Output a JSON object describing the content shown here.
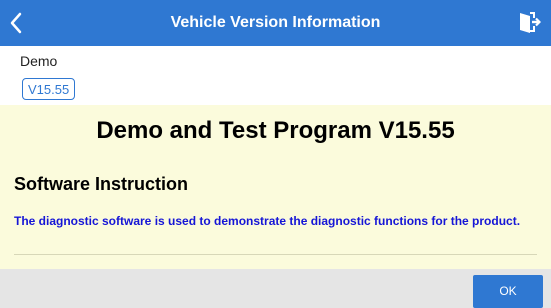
{
  "header": {
    "title": "Vehicle Version Information",
    "back_icon": "chevron-left-icon",
    "exit_icon": "exit-icon",
    "color": "#2f78d2"
  },
  "vehicle": {
    "name": "Demo",
    "version": "V15.55"
  },
  "content": {
    "program_title": "Demo and Test Program V15.55",
    "section_title": "Software Instruction",
    "instruction_text": "The diagnostic software is used to demonstrate the diagnostic functions for the product.",
    "instruction_color": "#1515d6",
    "background": "#fbfbdc"
  },
  "footer": {
    "ok_label": "OK"
  }
}
